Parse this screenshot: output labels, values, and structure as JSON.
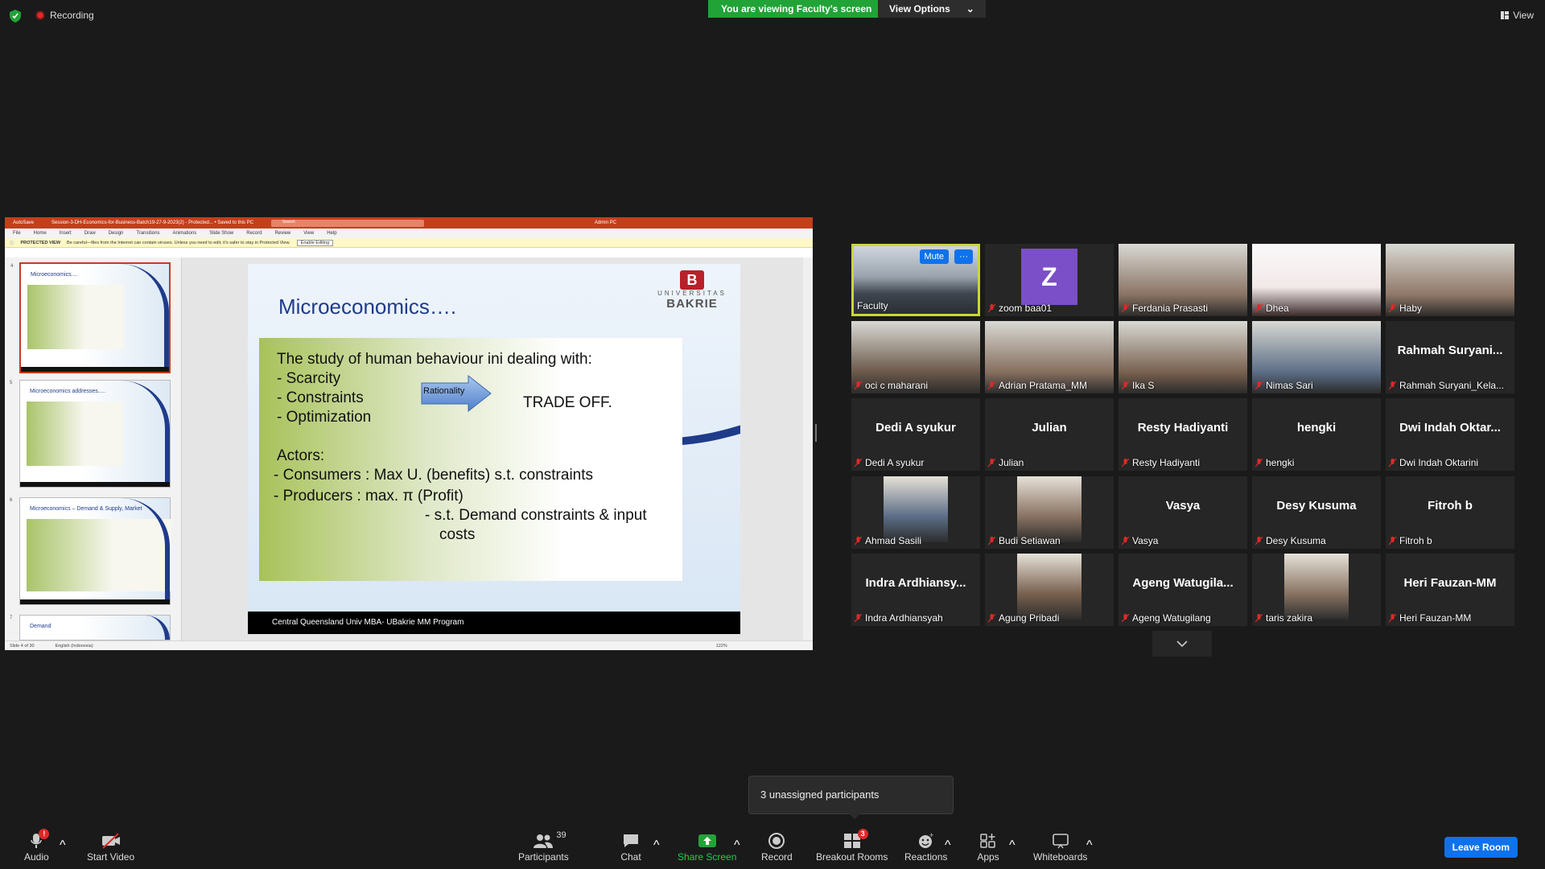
{
  "topbar": {
    "recording": "Recording",
    "viewing_banner": "You are viewing Faculty's screen",
    "view_options": "View Options",
    "view": "View"
  },
  "powerpoint": {
    "autosave": "AutoSave",
    "filename": "Session-3-DH-Economics-for-Business-Batch19-27-9-2023(2) - Protected... • Saved to this PC",
    "search": "Search",
    "user": "Admin PC",
    "menu": [
      "File",
      "Home",
      "Insert",
      "Draw",
      "Design",
      "Transitions",
      "Animations",
      "Slide Show",
      "Record",
      "Review",
      "View",
      "Help"
    ],
    "protected_label": "PROTECTED VIEW",
    "protected_text": "Be careful—files from the Internet can contain viruses. Unless you need to edit, it's safer to stay in Protected View.",
    "enable_editing": "Enable Editing",
    "status_slide": "Slide 4 of 30",
    "status_lang": "English (Indonesia)",
    "zoom": "122%",
    "thumbnails": [
      {
        "num": "4",
        "title": "Microeconomics...."
      },
      {
        "num": "5",
        "title": "Microeconomics addresses....."
      },
      {
        "num": "6",
        "title": "Microeconomics – Demand & Supply, Market"
      },
      {
        "num": "7",
        "title": "Demand"
      }
    ]
  },
  "slide": {
    "title": "Microeconomics….",
    "logo_top": "UNIVERSITAS",
    "logo_name": "BAKRIE",
    "logo_letter": "B",
    "line1": "The study of human behaviour ini dealing with:",
    "line2": "-   Scarcity",
    "line3": "-   Constraints",
    "line4": "-   Optimization",
    "rationality": "Rationality",
    "trade_off": "TRADE OFF.",
    "actors": "Actors:",
    "consumers": "- Consumers : Max U. (benefits) s.t. constraints",
    "producers": "- Producers   : max. π (Profit)",
    "st1": "-   s.t. Demand constraints & input",
    "st2": "costs",
    "footer": "Central Queensland Univ MBA- UBakrie MM Program"
  },
  "participants": [
    {
      "name": "Faculty",
      "big": "",
      "type": "room"
    },
    {
      "name": "zoom baa01",
      "big": "",
      "type": "avatar",
      "letter": "Z"
    },
    {
      "name": "Ferdania Prasasti",
      "big": "",
      "type": "video"
    },
    {
      "name": "Dhea",
      "big": "",
      "type": "doc"
    },
    {
      "name": "Haby",
      "big": "",
      "type": "video"
    },
    {
      "name": "oci c maharani",
      "big": "",
      "type": "video"
    },
    {
      "name": "Adrian Pratama_MM",
      "big": "",
      "type": "video"
    },
    {
      "name": "Ika S",
      "big": "",
      "type": "video"
    },
    {
      "name": "Nimas Sari",
      "big": "",
      "type": "video"
    },
    {
      "name": "Rahmah Suryani_Kela...",
      "big": "Rahmah  Suryani...",
      "type": "text"
    },
    {
      "name": "Dedi A syukur",
      "big": "Dedi A syukur",
      "type": "text"
    },
    {
      "name": "Julian",
      "big": "Julian",
      "type": "text"
    },
    {
      "name": "Resty Hadiyanti",
      "big": "Resty Hadiyanti",
      "type": "text"
    },
    {
      "name": "hengki",
      "big": "hengki",
      "type": "text"
    },
    {
      "name": "Dwi Indah Oktarini",
      "big": "Dwi  Indah  Oktar...",
      "type": "text"
    },
    {
      "name": "Ahmad Sasili",
      "big": "",
      "type": "photo"
    },
    {
      "name": "Budi Setiawan",
      "big": "",
      "type": "photo"
    },
    {
      "name": "Vasya",
      "big": "Vasya",
      "type": "text"
    },
    {
      "name": "Desy Kusuma",
      "big": "Desy Kusuma",
      "type": "text"
    },
    {
      "name": "Fitroh b",
      "big": "Fitroh b",
      "type": "text"
    },
    {
      "name": "Indra Ardhiansyah",
      "big": "Indra  Ardhiansy...",
      "type": "text"
    },
    {
      "name": "Agung Pribadi",
      "big": "",
      "type": "photo"
    },
    {
      "name": "Ageng Watugilang",
      "big": "Ageng  Watugila...",
      "type": "text"
    },
    {
      "name": "taris zakira",
      "big": "",
      "type": "photo"
    },
    {
      "name": "Heri Fauzan-MM",
      "big": "Heri Fauzan-MM",
      "type": "text"
    }
  ],
  "active_controls": {
    "mute": "Mute",
    "more": "···"
  },
  "tooltip": "3 unassigned participants",
  "toolbar": {
    "audio": "Audio",
    "start_video": "Start Video",
    "participants": "Participants",
    "participants_count": "39",
    "chat": "Chat",
    "share_screen": "Share Screen",
    "record": "Record",
    "breakout": "Breakout Rooms",
    "breakout_count": "3",
    "reactions": "Reactions",
    "apps": "Apps",
    "whiteboards": "Whiteboards",
    "leave": "Leave Room",
    "audio_badge": "!"
  },
  "colors": {
    "accent": "#0e72ed",
    "green": "#21a337",
    "active_border": "#c8d73a",
    "mic_off": "#e02828"
  }
}
